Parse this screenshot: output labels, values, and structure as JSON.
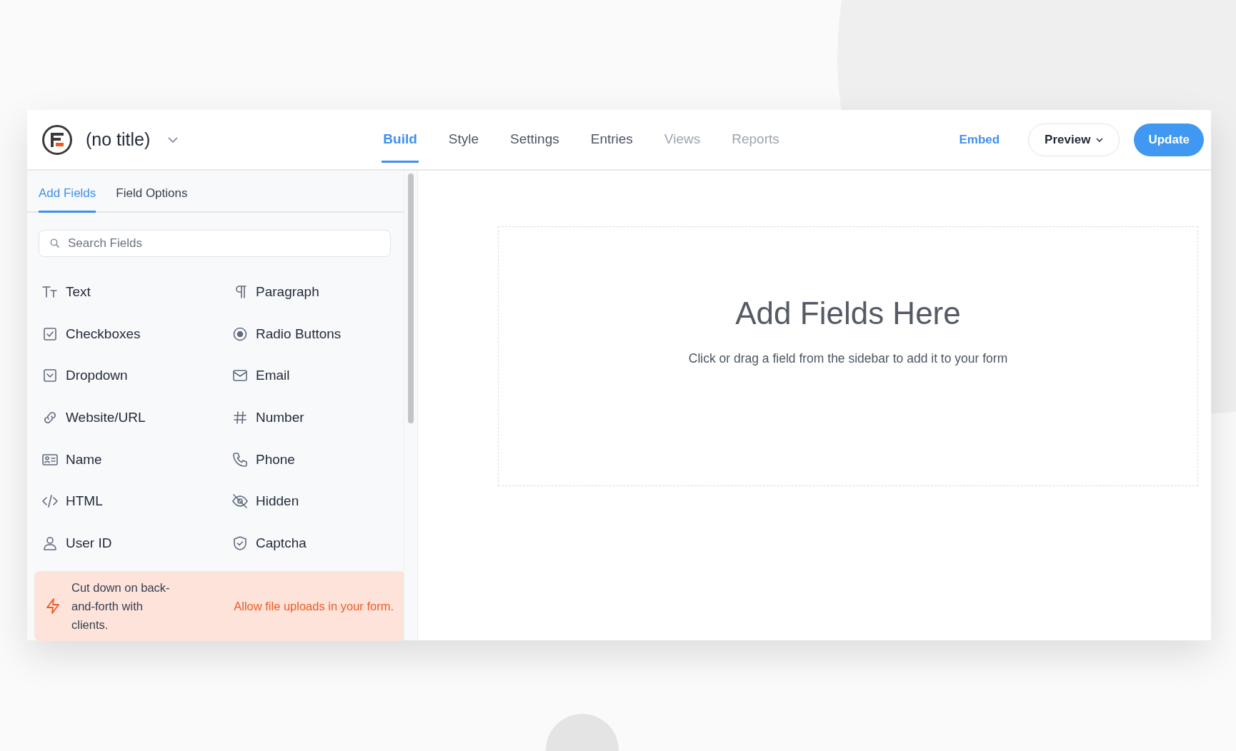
{
  "header": {
    "title": "(no title)",
    "tabs": [
      {
        "label": "Build",
        "selected": true,
        "disabled": false
      },
      {
        "label": "Style",
        "selected": false,
        "disabled": false
      },
      {
        "label": "Settings",
        "selected": false,
        "disabled": false
      },
      {
        "label": "Entries",
        "selected": false,
        "disabled": false
      },
      {
        "label": "Views",
        "selected": false,
        "disabled": true
      },
      {
        "label": "Reports",
        "selected": false,
        "disabled": true
      }
    ],
    "embed": "Embed",
    "preview": "Preview",
    "update": "Update"
  },
  "sidebar": {
    "tabs": [
      {
        "label": "Add Fields",
        "selected": true
      },
      {
        "label": "Field Options",
        "selected": false
      }
    ],
    "search": {
      "placeholder": "Search Fields"
    },
    "fields": [
      {
        "kind": "text",
        "label": "Text"
      },
      {
        "kind": "paragraph",
        "label": "Paragraph"
      },
      {
        "kind": "checkbox",
        "label": "Checkboxes"
      },
      {
        "kind": "radio",
        "label": "Radio Buttons"
      },
      {
        "kind": "dropdown",
        "label": "Dropdown"
      },
      {
        "kind": "email",
        "label": "Email"
      },
      {
        "kind": "url",
        "label": "Website/URL"
      },
      {
        "kind": "number",
        "label": "Number"
      },
      {
        "kind": "name",
        "label": "Name"
      },
      {
        "kind": "phone",
        "label": "Phone"
      },
      {
        "kind": "html",
        "label": "HTML"
      },
      {
        "kind": "hidden",
        "label": "Hidden"
      },
      {
        "kind": "user",
        "label": "User ID"
      },
      {
        "kind": "captcha",
        "label": "Captcha"
      }
    ],
    "promo": {
      "text": "Cut down on back-and-forth with clients.",
      "link": "Allow file uploads in your form."
    }
  },
  "canvas": {
    "title": "Add Fields Here",
    "hint": "Click or drag a field from the sidebar to add it to your form"
  }
}
